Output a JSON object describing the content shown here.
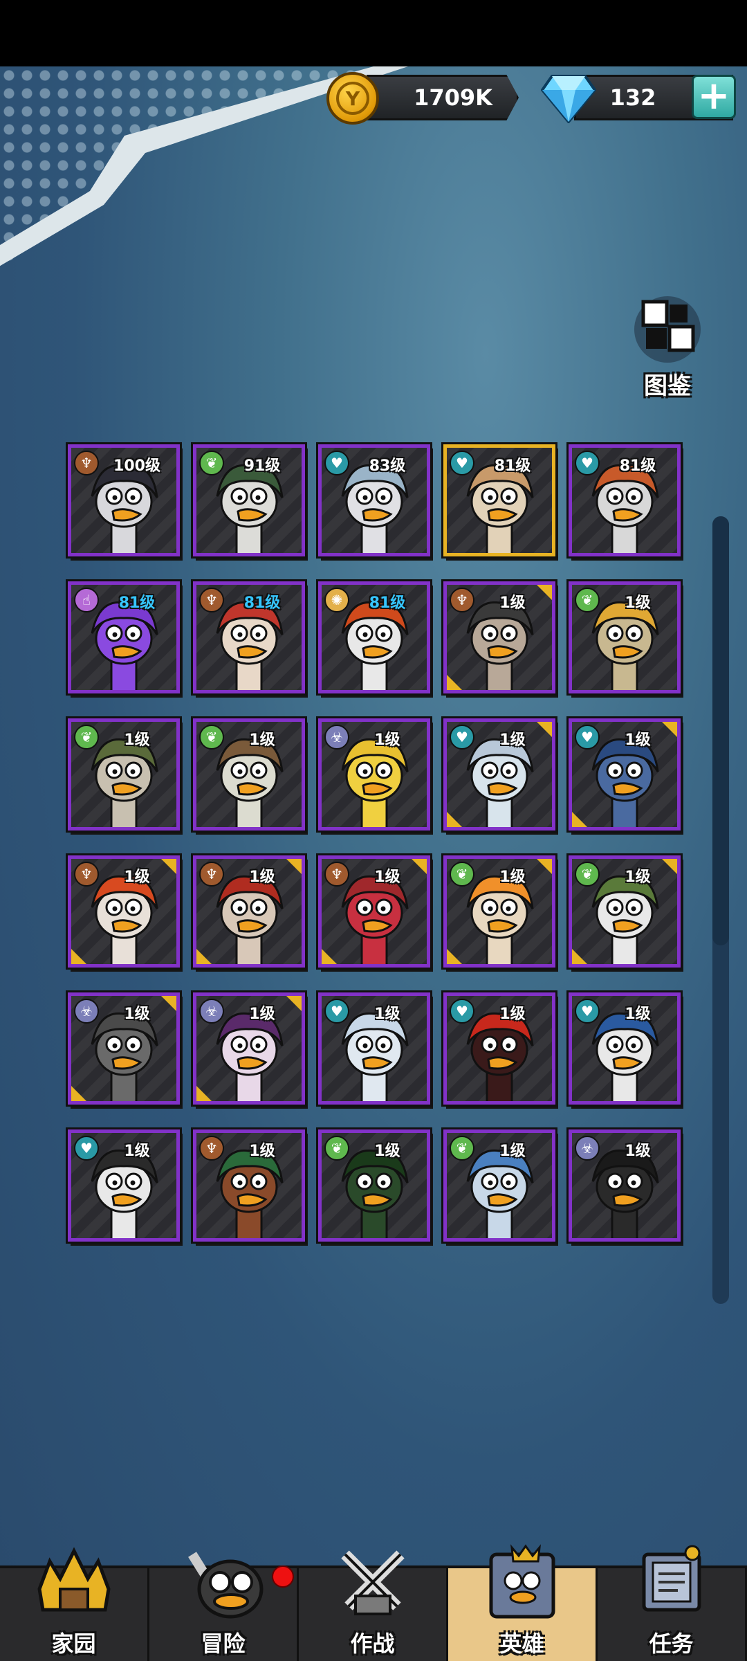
{
  "currency": {
    "coin_symbol": "Y",
    "gold": "1709K",
    "gems": "132",
    "add_symbol": "+"
  },
  "codex": {
    "label": "图鉴"
  },
  "heroes": [
    {
      "level": "100级",
      "badge": "fire",
      "frame": "purple",
      "level_color": "white",
      "hair": "#2b2b35",
      "face": "#d8d8dc"
    },
    {
      "level": "91级",
      "badge": "leaf",
      "frame": "purple",
      "level_color": "white",
      "hair": "#3a5a3a",
      "face": "#dcdcd8"
    },
    {
      "level": "83级",
      "badge": "water",
      "frame": "purple",
      "level_color": "white",
      "hair": "#9ab4c8",
      "face": "#e0e0e4"
    },
    {
      "level": "81级",
      "badge": "water",
      "frame": "gold",
      "level_color": "white",
      "hair": "#c89a6a",
      "face": "#e2d2b8"
    },
    {
      "level": "81级",
      "badge": "water",
      "frame": "purple",
      "level_color": "white",
      "hair": "#c85a2a",
      "face": "#d8d8d8"
    },
    {
      "level": "81级",
      "badge": "pink",
      "frame": "purple",
      "level_color": "cyan",
      "hair": "#7a3ad0",
      "face": "#8a4ae0"
    },
    {
      "level": "81级",
      "badge": "fire",
      "frame": "purple",
      "level_color": "cyan",
      "hair": "#c0362c",
      "face": "#e8d8c8"
    },
    {
      "level": "81级",
      "badge": "sun",
      "frame": "purple",
      "level_color": "cyan",
      "hair": "#d04a1c",
      "face": "#e8e8e8"
    },
    {
      "level": "1级",
      "badge": "fire",
      "frame": "purple-gold",
      "level_color": "white",
      "hair": "#3a3a3a",
      "face": "#b8a898"
    },
    {
      "level": "1级",
      "badge": "leaf",
      "frame": "purple",
      "level_color": "white",
      "hair": "#e0a834",
      "face": "#c8b890"
    },
    {
      "level": "1级",
      "badge": "leaf",
      "frame": "purple",
      "level_color": "white",
      "hair": "#5a6a3a",
      "face": "#c8c0b0"
    },
    {
      "level": "1级",
      "badge": "leaf",
      "frame": "purple",
      "level_color": "white",
      "hair": "#7a5a3a",
      "face": "#dcdcd0"
    },
    {
      "level": "1级",
      "badge": "bio",
      "frame": "purple",
      "level_color": "white",
      "hair": "#e8c030",
      "face": "#f0d040"
    },
    {
      "level": "1级",
      "badge": "water",
      "frame": "purple-gold",
      "level_color": "white",
      "hair": "#b8c8d8",
      "face": "#d8e4ec"
    },
    {
      "level": "1级",
      "badge": "water",
      "frame": "purple-gold",
      "level_color": "white",
      "hair": "#2a4a80",
      "face": "#4a6aa0"
    },
    {
      "level": "1级",
      "badge": "fire",
      "frame": "purple-gold",
      "level_color": "white",
      "hair": "#d84a20",
      "face": "#e8e0d8"
    },
    {
      "level": "1级",
      "badge": "fire",
      "frame": "purple-gold",
      "level_color": "white",
      "hair": "#b02c20",
      "face": "#d8c8b8"
    },
    {
      "level": "1级",
      "badge": "fire",
      "frame": "purple-gold",
      "level_color": "white",
      "hair": "#a0282c",
      "face": "#c83040"
    },
    {
      "level": "1级",
      "badge": "leaf",
      "frame": "purple-gold",
      "level_color": "white",
      "hair": "#f0902a",
      "face": "#e8d8c0"
    },
    {
      "level": "1级",
      "badge": "leaf",
      "frame": "purple-gold",
      "level_color": "white",
      "hair": "#5a7a3a",
      "face": "#e8e8e8"
    },
    {
      "level": "1级",
      "badge": "bio",
      "frame": "purple-gold",
      "level_color": "white",
      "hair": "#4a4a4a",
      "face": "#6a6a6a"
    },
    {
      "level": "1级",
      "badge": "bio",
      "frame": "purple-gold",
      "level_color": "white",
      "hair": "#5a2a6a",
      "face": "#e8d8e8"
    },
    {
      "level": "1级",
      "badge": "water",
      "frame": "purple",
      "level_color": "white",
      "hair": "#c8d8e8",
      "face": "#e0e8f0"
    },
    {
      "level": "1级",
      "badge": "water",
      "frame": "purple",
      "level_color": "white",
      "hair": "#c8281c",
      "face": "#3a1a1a"
    },
    {
      "level": "1级",
      "badge": "water",
      "frame": "purple",
      "level_color": "white",
      "hair": "#2a5aa0",
      "face": "#e8e8e8"
    },
    {
      "level": "1级",
      "badge": "water",
      "frame": "purple",
      "level_color": "white",
      "hair": "#2a2a2a",
      "face": "#e8e8e8"
    },
    {
      "level": "1级",
      "badge": "fire",
      "frame": "purple",
      "level_color": "white",
      "hair": "#2a6a3a",
      "face": "#8a4a2a"
    },
    {
      "level": "1级",
      "badge": "leaf",
      "frame": "purple",
      "level_color": "white",
      "hair": "#1a3a1a",
      "face": "#2a4a2a"
    },
    {
      "level": "1级",
      "badge": "leaf",
      "frame": "purple",
      "level_color": "white",
      "hair": "#4a80c0",
      "face": "#c8d8e8"
    },
    {
      "level": "1级",
      "badge": "bio",
      "frame": "purple",
      "level_color": "white",
      "hair": "#1a1a1a",
      "face": "#2a2a2a"
    }
  ],
  "badge_icons": {
    "fire": "♆",
    "leaf": "❦",
    "water": "♥",
    "bio": "☣",
    "pink": "☝",
    "sun": "✺"
  },
  "nav": [
    {
      "label": "家园",
      "icon": "home-castle-icon",
      "active": false,
      "dot": false
    },
    {
      "label": "冒险",
      "icon": "adventure-duck-icon",
      "active": false,
      "dot": true
    },
    {
      "label": "作战",
      "icon": "battle-swords-icon",
      "active": false,
      "dot": false
    },
    {
      "label": "英雄",
      "icon": "heroes-book-icon",
      "active": true,
      "dot": false
    },
    {
      "label": "任务",
      "icon": "quest-scroll-icon",
      "active": false,
      "dot": false
    }
  ],
  "colors": {
    "frame_purple": "#8232c8",
    "frame_gold": "#e8b324",
    "level_cyan": "#36c6ff",
    "nav_active": "#e9c789",
    "notification": "#e11111"
  }
}
